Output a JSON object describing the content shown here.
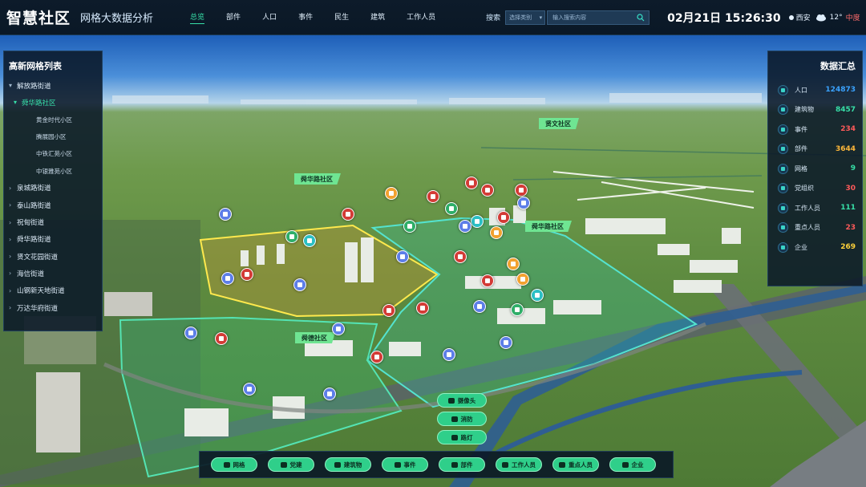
{
  "header": {
    "brand": "智慧社区",
    "subtitle": "网格大数据分析",
    "nav": [
      {
        "label": "总览",
        "active": true
      },
      {
        "label": "部件",
        "active": false
      },
      {
        "label": "人口",
        "active": false
      },
      {
        "label": "事件",
        "active": false
      },
      {
        "label": "民生",
        "active": false
      },
      {
        "label": "建筑",
        "active": false
      },
      {
        "label": "工作人员",
        "active": false
      }
    ],
    "search_label": "搜索",
    "search_select": "选择类别",
    "search_placeholder": "输入搜索内容",
    "datetime": "02月21日 15:26:30",
    "weather": {
      "city": "西安",
      "temp": "12°",
      "aqi": "中度",
      "icon": "cloud-icon"
    }
  },
  "left_panel": {
    "title": "高新网格列表",
    "items": [
      {
        "label": "解放路街道",
        "level": 0,
        "arrow": "▾"
      },
      {
        "label": "舜华路社区",
        "level": 1,
        "arrow": "▾",
        "active": true
      },
      {
        "label": "黄金时代小区",
        "level": 2
      },
      {
        "label": "腾展园小区",
        "level": 2
      },
      {
        "label": "中铁汇苑小区",
        "level": 2
      },
      {
        "label": "中银雅苑小区",
        "level": 2
      },
      {
        "label": "泉城路街道",
        "level": 0,
        "arrow": "›"
      },
      {
        "label": "泰山路街道",
        "level": 0,
        "arrow": "›"
      },
      {
        "label": "祝甸街道",
        "level": 0,
        "arrow": "›"
      },
      {
        "label": "舜华路街道",
        "level": 0,
        "arrow": "›"
      },
      {
        "label": "贤文花园街道",
        "level": 0,
        "arrow": "›"
      },
      {
        "label": "海信街道",
        "level": 0,
        "arrow": "›"
      },
      {
        "label": "山钢新天地街道",
        "level": 0,
        "arrow": "›"
      },
      {
        "label": "万达华府街道",
        "level": 0,
        "arrow": "›"
      }
    ]
  },
  "right_panel": {
    "title": "数据汇总",
    "stats": [
      {
        "label": "人口",
        "value": "124873",
        "color": "#3aa3ff"
      },
      {
        "label": "建筑物",
        "value": "8457",
        "color": "#37e0a8"
      },
      {
        "label": "事件",
        "value": "234",
        "color": "#ff5a5a"
      },
      {
        "label": "部件",
        "value": "3644",
        "color": "#ffb83a"
      },
      {
        "label": "网格",
        "value": "9",
        "color": "#37e0a8"
      },
      {
        "label": "党组织",
        "value": "30",
        "color": "#ff5a5a"
      },
      {
        "label": "工作人员",
        "value": "111",
        "color": "#37e0a8"
      },
      {
        "label": "重点人员",
        "value": "23",
        "color": "#ff5a5a"
      },
      {
        "label": "企业",
        "value": "269",
        "color": "#ffd23a"
      }
    ]
  },
  "map_labels": [
    "贤文社区",
    "舜华路社区",
    "舜华路社区",
    "舜德社区"
  ],
  "layer_buttons": [
    "摄像头",
    "消防",
    "路灯"
  ],
  "bottom_buttons": [
    "网格",
    "党建",
    "建筑物",
    "事件",
    "部件",
    "工作人员",
    "重点人员",
    "企业"
  ]
}
